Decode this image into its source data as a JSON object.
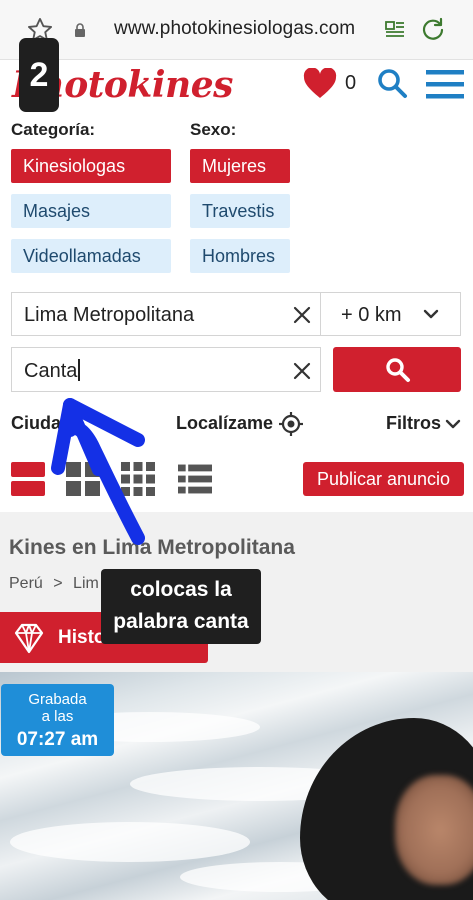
{
  "browser": {
    "url": "www.photokinesiologas.com"
  },
  "header": {
    "logo_text": "Photokines",
    "favorites_count": "0",
    "brand_color": "#d0202e"
  },
  "tutorial": {
    "step_number": "2",
    "callout_line1": "colocas la",
    "callout_line2": "palabra canta"
  },
  "filters": {
    "category_label": "Categoría:",
    "categories": [
      {
        "label": "Kinesiologas",
        "active": true
      },
      {
        "label": "Masajes",
        "active": false
      },
      {
        "label": "Videollamadas",
        "active": false
      }
    ],
    "sex_label": "Sexo:",
    "sexes": [
      {
        "label": "Mujeres",
        "active": true
      },
      {
        "label": "Travestis",
        "active": false
      },
      {
        "label": "Hombres",
        "active": false
      }
    ]
  },
  "location": {
    "value": "Lima Metropolitana",
    "radius": "+ 0 km"
  },
  "search": {
    "value": "Canta"
  },
  "controls": {
    "city_label": "Ciudad",
    "locate_label": "Localízame",
    "filters_label": "Filtros",
    "publish_label": "Publicar anuncio"
  },
  "listing": {
    "title": "Kines en Lima Metropolitana",
    "breadcrumb_country": "Perú",
    "breadcrumb_sep": ">",
    "breadcrumb_city": "Lim",
    "history_label": "Histo",
    "badge_line1": "Grabada",
    "badge_line2": "a las",
    "badge_time": "07:27 am"
  }
}
